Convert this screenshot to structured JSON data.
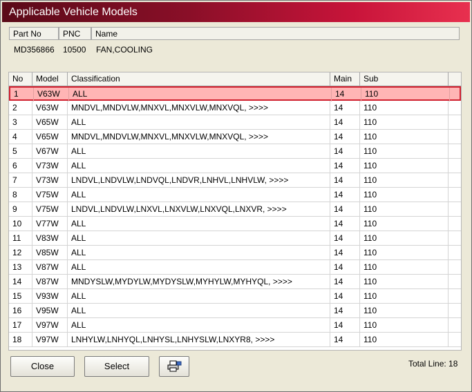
{
  "window": {
    "title": "Applicable Vehicle Models"
  },
  "info": {
    "headers": [
      "Part No",
      "PNC",
      "Name"
    ],
    "values": [
      "MD356866",
      "10500",
      "FAN,COOLING"
    ]
  },
  "grid": {
    "headers": [
      "No",
      "Model",
      "Classification",
      "Main",
      "Sub"
    ],
    "rows": [
      [
        "1",
        "V63W",
        "ALL",
        "14",
        "110"
      ],
      [
        "2",
        "V63W",
        "MNDVL,MNDVLW,MNXVL,MNXVLW,MNXVQL,  >>>>",
        "14",
        "110"
      ],
      [
        "3",
        "V65W",
        "ALL",
        "14",
        "110"
      ],
      [
        "4",
        "V65W",
        "MNDVL,MNDVLW,MNXVL,MNXVLW,MNXVQL,  >>>>",
        "14",
        "110"
      ],
      [
        "5",
        "V67W",
        "ALL",
        "14",
        "110"
      ],
      [
        "6",
        "V73W",
        "ALL",
        "14",
        "110"
      ],
      [
        "7",
        "V73W",
        "LNDVL,LNDVLW,LNDVQL,LNDVR,LNHVL,LNHVLW,  >>>>",
        "14",
        "110"
      ],
      [
        "8",
        "V75W",
        "ALL",
        "14",
        "110"
      ],
      [
        "9",
        "V75W",
        "LNDVL,LNDVLW,LNXVL,LNXVLW,LNXVQL,LNXVR,  >>>>",
        "14",
        "110"
      ],
      [
        "10",
        "V77W",
        "ALL",
        "14",
        "110"
      ],
      [
        "11",
        "V83W",
        "ALL",
        "14",
        "110"
      ],
      [
        "12",
        "V85W",
        "ALL",
        "14",
        "110"
      ],
      [
        "13",
        "V87W",
        "ALL",
        "14",
        "110"
      ],
      [
        "14",
        "V87W",
        "MNDYSLW,MYDYLW,MYDYSLW,MYHYLW,MYHYQL,  >>>>",
        "14",
        "110"
      ],
      [
        "15",
        "V93W",
        "ALL",
        "14",
        "110"
      ],
      [
        "16",
        "V95W",
        "ALL",
        "14",
        "110"
      ],
      [
        "17",
        "V97W",
        "ALL",
        "14",
        "110"
      ],
      [
        "18",
        "V97W",
        "LNHYLW,LNHYQL,LNHYSL,LNHYSLW,LNXYR8,  >>>>",
        "14",
        "110"
      ]
    ],
    "selected_row": 1
  },
  "buttons": {
    "close": "Close",
    "select": "Select",
    "print_icon": "printer-icon"
  },
  "status": {
    "total": "Total Line: 18"
  },
  "colors": {
    "title_start": "#5a0a18",
    "title_end": "#e8304f",
    "selection_fill": "#ffb5b5",
    "selection_border": "#d01f2e"
  }
}
